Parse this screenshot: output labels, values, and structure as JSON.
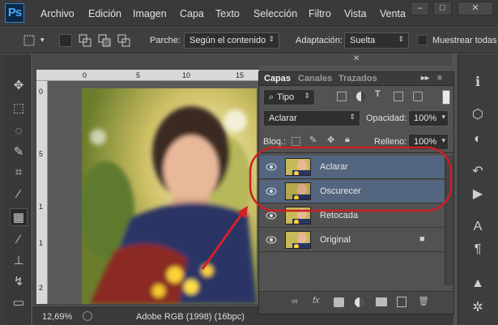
{
  "app": {
    "logo": "Ps"
  },
  "menu": [
    "Archivo",
    "Edición",
    "Imagen",
    "Capa",
    "Texto",
    "Selección",
    "Filtro",
    "Vista",
    "Venta"
  ],
  "window_controls": {
    "minimize": "–",
    "maximize": "□",
    "close": "✕"
  },
  "options_bar": {
    "parche_label": "Parche:",
    "parche_value": "Según el contenido",
    "adaptacion_label": "Adaptación:",
    "adaptacion_value": "Suelta",
    "muestrear_label": "Muestrear todas"
  },
  "ruler": {
    "top_ticks": [
      "0",
      "5",
      "10",
      "15"
    ],
    "left_ticks": [
      "0",
      "5",
      "1",
      "1",
      "2"
    ]
  },
  "status": {
    "zoom": "12,69%",
    "profile": "Adobe RGB (1998) (16bpc)"
  },
  "layers_panel": {
    "tabs": [
      "Capas",
      "Canales",
      "Trazados"
    ],
    "filter_label": "Tipo",
    "blend_mode": "Aclarar",
    "opacity_label": "Opacidad:",
    "opacity_value": "100%",
    "lock_label": "Bloq.:",
    "fill_label": "Relleno:",
    "fill_value": "100%",
    "layers": [
      {
        "name": "Aclarar",
        "selected": true
      },
      {
        "name": "Oscurecer",
        "selected": true
      },
      {
        "name": "Retocada",
        "selected": false
      },
      {
        "name": "Original",
        "selected": false,
        "locked": true
      }
    ]
  },
  "colors": {
    "highlight_ellipse": "#cc1f24",
    "selection": "#53657f",
    "brand": "#49a9ff"
  }
}
